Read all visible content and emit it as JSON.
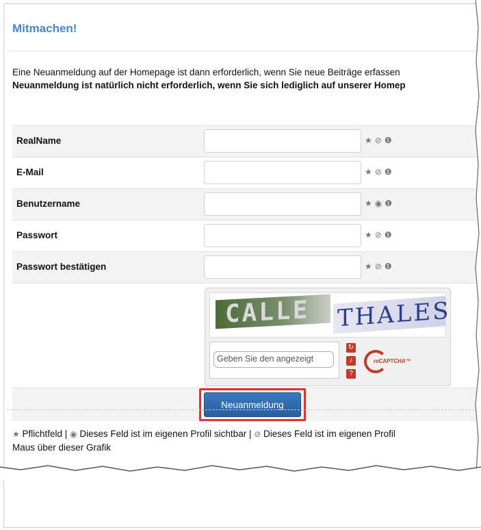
{
  "title": "Mitmachen!",
  "intro": {
    "line1": "Eine Neuanmeldung auf der Homepage ist dann erforderlich, wenn Sie neue Beiträge erfassen",
    "line2": "Neuanmeldung ist natürlich nicht erforderlich, wenn Sie sich lediglich auf unserer Homep"
  },
  "fields": [
    {
      "label": "RealName"
    },
    {
      "label": "E-Mail"
    },
    {
      "label": "Benutzername"
    },
    {
      "label": "Passwort"
    },
    {
      "label": "Passwort bestätigen"
    }
  ],
  "icons": {
    "required": "star-icon",
    "visible": "eye-icon",
    "hidden": "eye-slash-icon",
    "info": "info-icon"
  },
  "captcha": {
    "word1": "CALLE",
    "word2": "THALES",
    "placeholder": "Geben Sie den angezeigt",
    "logo": "reCAPTCHA™"
  },
  "submit_label": "Neuanmeldung",
  "legend": {
    "line1_a": "Pflichtfeld |",
    "line1_b": "Dieses Feld ist im eigenen Profil sichtbar |",
    "line1_c": "Dieses Feld ist im eigenen Profil",
    "line2": "Maus über dieser Grafik"
  },
  "colors": {
    "title": "#4a86c8",
    "button": "#2f6db0",
    "highlight": "#e03131",
    "captcha_red": "#c0392b"
  }
}
